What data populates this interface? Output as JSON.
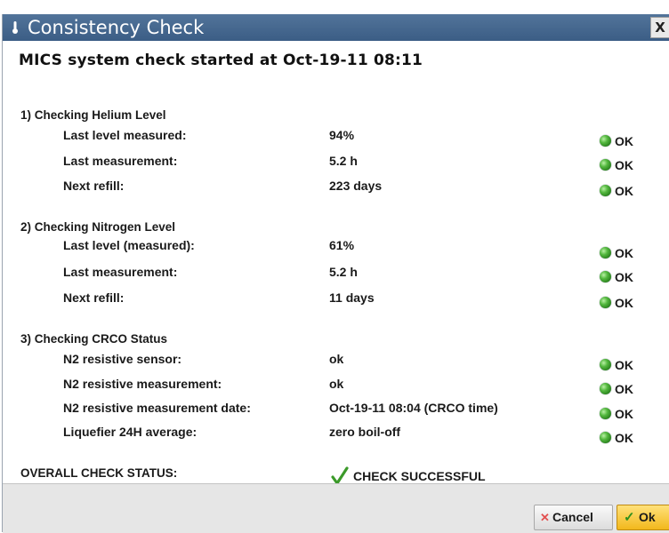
{
  "window": {
    "title": "Consistency Check",
    "close_label": "X"
  },
  "header": {
    "text": "MICS system check started at Oct-19-11  08:11"
  },
  "sections": [
    {
      "title": "1) Checking Helium Level",
      "rows": [
        {
          "label": "Last level measured:",
          "value": "94%",
          "status": "OK"
        },
        {
          "label": "Last measurement:",
          "value": "5.2 h",
          "status": "OK"
        },
        {
          "label": "Next refill:",
          "value": "223 days",
          "status": "OK"
        }
      ]
    },
    {
      "title": "2) Checking Nitrogen Level",
      "rows": [
        {
          "label": "Last level (measured):",
          "value": "61%",
          "status": "OK"
        },
        {
          "label": "Last measurement:",
          "value": "5.2 h",
          "status": "OK"
        },
        {
          "label": "Next refill:",
          "value": "11 days",
          "status": "OK"
        }
      ]
    },
    {
      "title": "3) Checking CRCO Status",
      "rows": [
        {
          "label": "N2 resistive sensor:",
          "value": "ok",
          "status": "OK"
        },
        {
          "label": "N2 resistive measurement:",
          "value": "ok",
          "status": "OK"
        },
        {
          "label": "N2 resistive measurement date:",
          "value": "Oct-19-11  08:04 (CRCO time)",
          "status": "OK"
        },
        {
          "label": "Liquefier 24H average:",
          "value": "zero boil-off",
          "status": "OK"
        }
      ]
    }
  ],
  "overall": {
    "label": "OVERALL CHECK STATUS:",
    "result": "CHECK SUCCESSFUL"
  },
  "buttons": {
    "cancel_label": "Cancel",
    "ok_label": "Ok"
  },
  "colors": {
    "titlebar": "#3b5d85",
    "status_ok": "#3c9a2a",
    "ok_button": "#f2b81c",
    "cancel_icon": "#e25050"
  },
  "icons": {
    "title": "thermometer-icon",
    "status": "green-led-icon",
    "overall": "green-checkmark-icon",
    "cancel": "x-icon",
    "ok": "checkmark-icon"
  }
}
